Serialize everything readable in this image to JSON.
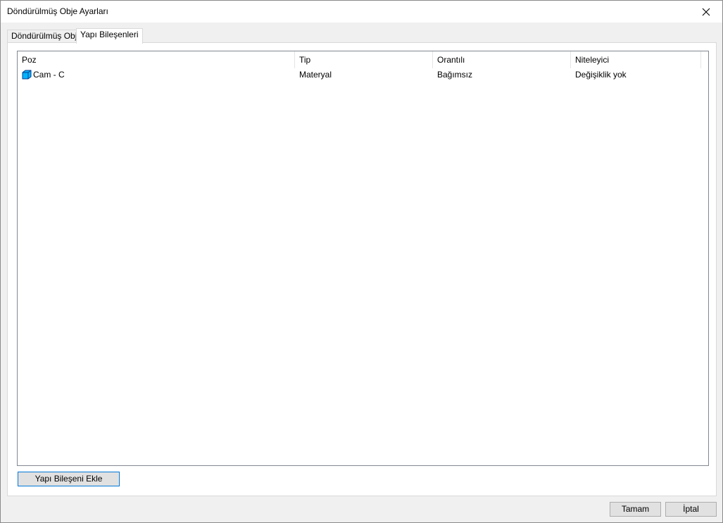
{
  "window": {
    "title": "Döndürülmüş Obje Ayarları"
  },
  "tabs": [
    {
      "label": "Döndürülmüş Obje",
      "active": false
    },
    {
      "label": "Yapı Bileşenleri",
      "active": true
    }
  ],
  "table": {
    "columns": [
      "Poz",
      "Tip",
      "Orantılı",
      "Niteleyici"
    ],
    "rows": [
      {
        "icon": "cube-icon",
        "poz": "Cam - C",
        "tip": "Materyal",
        "orantili": "Bağımsız",
        "niteleyici": "Değişiklik yok"
      }
    ]
  },
  "buttons": {
    "add_component": "Yapı Bileşeni Ekle",
    "ok": "Tamam",
    "cancel": "İptal"
  },
  "colors": {
    "accent": "#0078d7",
    "icon_fill": "#00b4ff"
  }
}
